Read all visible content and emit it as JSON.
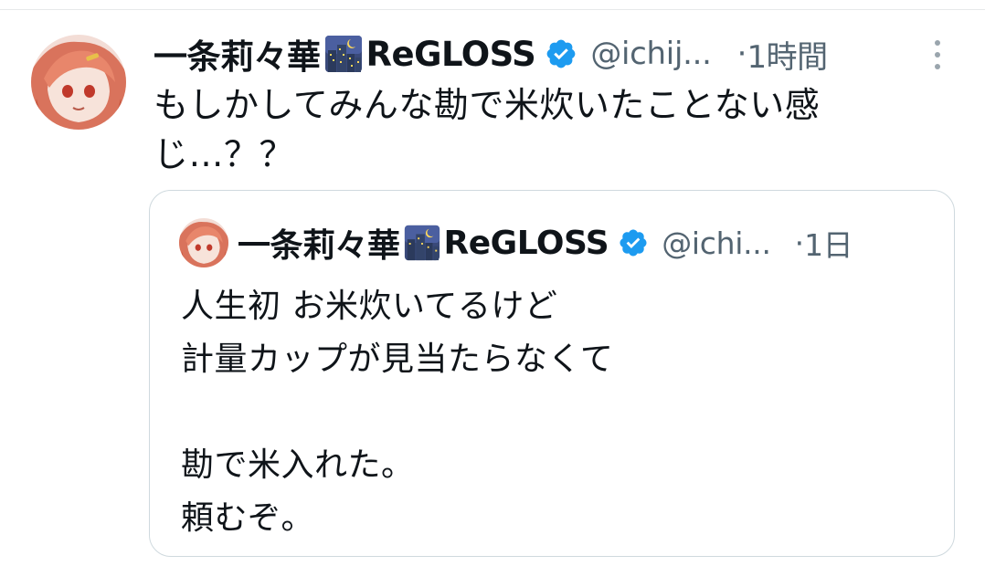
{
  "tweet": {
    "author_name": "一条莉々華",
    "author_emoji": "city-night-emoji",
    "author_suffix": "ReGLOSS",
    "verified": true,
    "handle": "@ichij...",
    "separator": "·",
    "time": "1時間",
    "text": "もしかしてみんな勘で米炊いたことない感じ…？？"
  },
  "quote": {
    "author_name": "一条莉々華",
    "author_emoji": "city-night-emoji",
    "author_suffix": "ReGLOSS",
    "verified": true,
    "handle": "@ichi...",
    "separator": "·",
    "time": "1日",
    "lines": [
      "人生初 お米炊いてるけど",
      "計量カップが見当たらなくて",
      "",
      "勘で米入れた。",
      "頼むぞ。"
    ]
  },
  "colors": {
    "verified_badge": "#1d9bf0",
    "secondary_text": "#536471",
    "primary_text": "#0f1419",
    "border": "#cfd9de"
  }
}
